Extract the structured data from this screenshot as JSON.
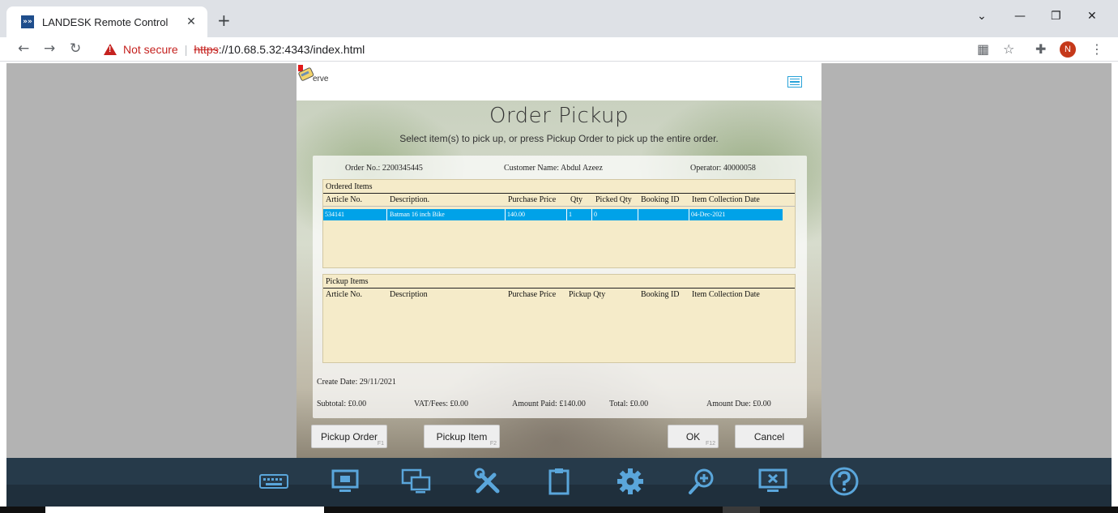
{
  "browser": {
    "tab_title": "LANDESK Remote Control",
    "tab_favicon": "»»",
    "tab_close": "✕",
    "new_tab": "+",
    "not_secure": "Not secure",
    "separator": "|",
    "url_scheme": "https",
    "url_rest": "://10.68.5.32:4343/index.html",
    "avatar_letter": "N"
  },
  "app": {
    "logo_text": "erve",
    "title": "Order Pickup",
    "subtitle": "Select item(s) to pick up, or press Pickup Order to pick up the entire order.",
    "order_no": "Order No.: 2200345445",
    "customer_name": "Customer Name: Abdul Azeez",
    "operator": "Operator: 40000058",
    "ordered_items": {
      "title": "Ordered Items",
      "columns": [
        "Article No.",
        "Description.",
        "Purchase Price",
        "Qty",
        "Picked Qty",
        "Booking ID",
        "Item Collection Date"
      ],
      "rows": [
        {
          "article": "534141",
          "description": "Batman 16 inch Bike",
          "price": "140.00",
          "qty": "1",
          "picked": "0",
          "booking": "",
          "date": "04-Dec-2021"
        }
      ]
    },
    "pickup_items": {
      "title": "Pickup Items",
      "columns": [
        "Article No.",
        "Description",
        "Purchase Price",
        "Pickup Qty",
        "Booking ID",
        "Item Collection Date"
      ]
    },
    "create_date": "Create Date: 29/11/2021",
    "subtotal": "Subtotal: £0.00",
    "vat": "VAT/Fees: £0.00",
    "amount_paid": "Amount Paid: £140.00",
    "total": "Total: £0.00",
    "amount_due": "Amount Due: £0.00",
    "buttons": {
      "pickup_order": "Pickup Order",
      "pickup_order_key": "F1",
      "pickup_item": "Pickup Item",
      "pickup_item_key": "F2",
      "ok": "OK",
      "ok_key": "F12",
      "cancel": "Cancel"
    }
  },
  "remote_toolbar": {
    "icons": [
      "keyboard-icon",
      "monitor-icon",
      "multi-monitor-icon",
      "tools-icon",
      "clipboard-icon",
      "gear-icon",
      "zoom-in-icon",
      "close-screen-icon",
      "help-icon"
    ],
    "accent": "#5aa6db"
  }
}
